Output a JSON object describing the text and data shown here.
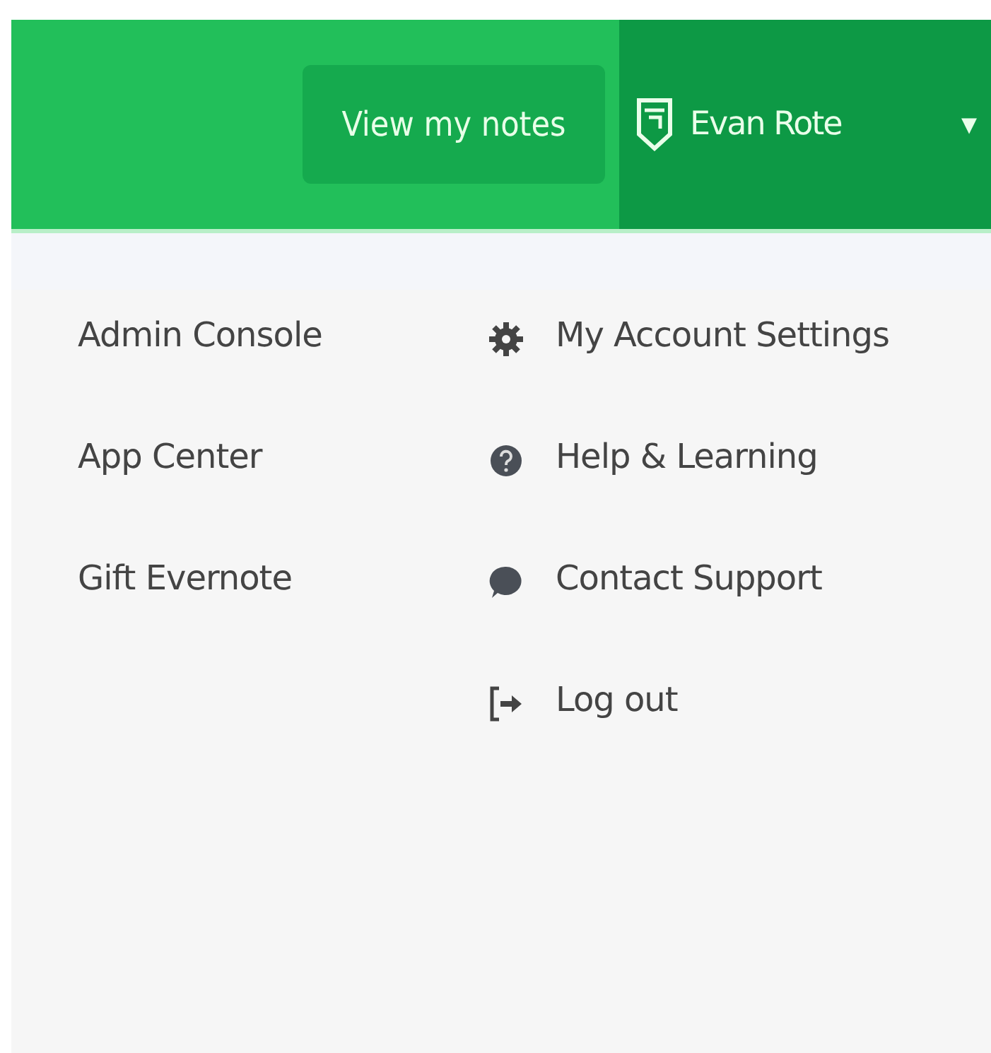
{
  "header": {
    "notes_button": "View my notes",
    "user": {
      "name": "Evan Rote",
      "caret": "▾"
    }
  },
  "menu": {
    "left": [
      {
        "label": "Admin Console"
      },
      {
        "label": "App Center"
      },
      {
        "label": "Gift Evernote"
      }
    ],
    "right": [
      {
        "label": "My Account Settings",
        "kind": "settings"
      },
      {
        "label": "Help & Learning",
        "kind": "help"
      },
      {
        "label": "Contact Support",
        "kind": "chat"
      },
      {
        "label": "Log out",
        "kind": "logout"
      }
    ]
  }
}
